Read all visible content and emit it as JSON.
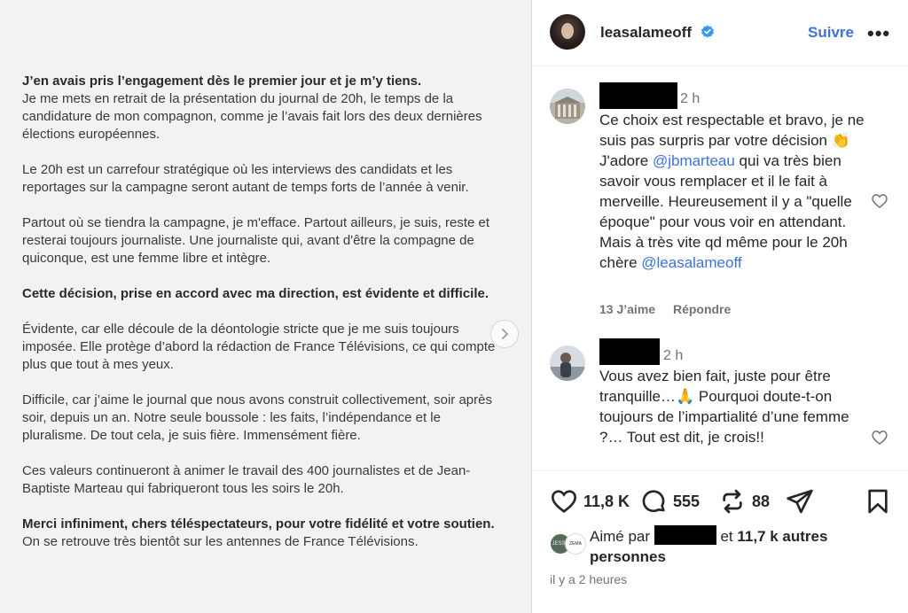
{
  "post": {
    "paragraphs": [
      {
        "bold": "J’en avais pris l’engagement dès le premier jour et je m’y tiens.",
        "text": "Je me mets en retrait de la présentation du journal de 20h, le temps de la candidature de mon compagnon, comme je l’avais fait lors des deux dernières élections européennes."
      },
      {
        "bold": "",
        "text": "Le 20h est un carrefour stratégique où les interviews des candidats et les reportages sur la campagne seront autant de temps forts de l’année à venir."
      },
      {
        "bold": "",
        "text": "Partout où se tiendra la campagne, je m'efface. Partout ailleurs, je suis, reste et resterai toujours journaliste. Une journaliste qui, avant d'être la compagne de quiconque, est une femme libre et intègre."
      },
      {
        "bold": "Cette décision, prise en accord avec ma direction, est évidente et difficile.",
        "text": ""
      },
      {
        "bold": "",
        "text": "Évidente, car elle découle de la déontologie stricte que je me suis toujours imposée. Elle protège d’abord la rédaction de France Télévisions, ce qui compte plus que tout à mes yeux."
      },
      {
        "bold": "",
        "text": "Difficile, car j’aime le journal que nous avons construit collectivement, soir après soir, depuis un an. Notre seule boussole : les faits, l’indépendance et le pluralisme. De tout cela, je suis fière. Immensément fière."
      },
      {
        "bold": "",
        "text": "Ces valeurs continueront à animer le travail des 400 journalistes et de Jean-Baptiste Marteau qui fabriqueront tous les soirs le 20h."
      },
      {
        "bold": "Merci infiniment, chers téléspectateurs, pour votre fidélité et votre soutien.",
        "text": " On se retrouve très bientôt sur les antennes de France Télévisions."
      }
    ]
  },
  "header": {
    "username": "leasalameoff",
    "follow_label": "Suivre",
    "more_label": "•••"
  },
  "comments": [
    {
      "time": "2 h",
      "parts": [
        {
          "t": "Ce choix est respectable et bravo, je ne suis pas surpris par votre décision 👏 J'adore ",
          "m": false
        },
        {
          "t": "@jbmarteau",
          "m": true
        },
        {
          "t": " qui va très bien savoir vous remplacer et il le fait à merveille. Heureusement il y a \"quelle époque\" pour vous voir en attendant. Mais à très vite qd même pour le 20h chère ",
          "m": false
        },
        {
          "t": "@leasalameoff",
          "m": true
        }
      ],
      "likes": "13 J’aime",
      "reply": "Répondre"
    },
    {
      "time": "2 h",
      "text": "Vous avez bien fait, juste pour être tranquille…🙏 Pourquoi doute-t-on toujours de l’impartialité d’une femme ?… Tout est dit, je crois!!"
    }
  ],
  "actions": {
    "likes_count": "11,8 K",
    "comments_count": "555",
    "reposts_count": "88"
  },
  "liked_by": {
    "prefix": "Aimé par ",
    "and": " et ",
    "others": "11,7 k autres personnes",
    "avatar1": "JESSE",
    "avatar2": "ZEMA"
  },
  "timestamp": "il y a 2 heures",
  "colors": {
    "link": "#3d72d9",
    "verified": "#3897f0"
  }
}
